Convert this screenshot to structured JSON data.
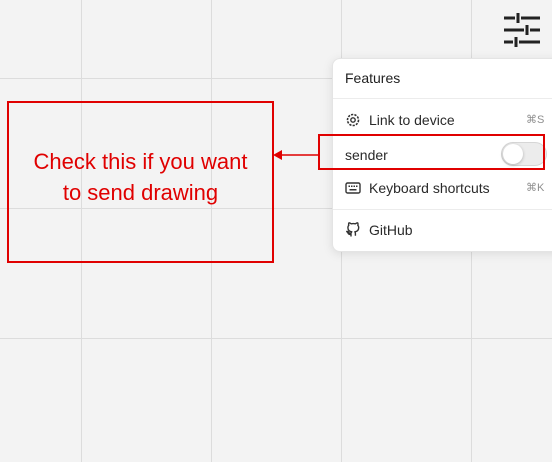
{
  "menu": {
    "title": "Features",
    "items": [
      {
        "label": "Link to device",
        "shortcut": "⌘S",
        "icon": "gear-icon"
      },
      {
        "label": "Keyboard shortcuts",
        "shortcut": "⌘K",
        "icon": "keyboard-icon"
      },
      {
        "label": "GitHub",
        "icon": "github-icon"
      }
    ],
    "sender": {
      "label": "sender",
      "checked": false
    }
  },
  "annotation": {
    "text_line1": "Check this if you want",
    "text_line2": "to send drawing",
    "color": "#e00000"
  },
  "icons": {
    "settings": "sliders-icon"
  }
}
